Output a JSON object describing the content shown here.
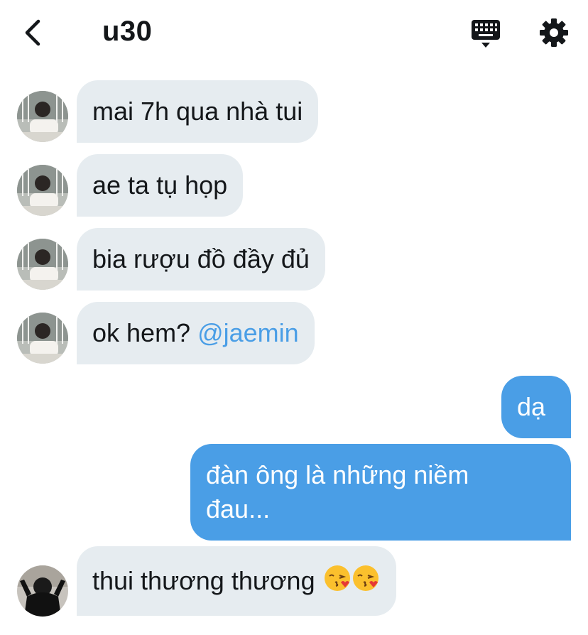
{
  "header": {
    "title": "u30",
    "back_icon": "chevron-left-icon",
    "keyboard_icon": "keyboard-icon",
    "settings_icon": "gear-icon"
  },
  "colors": {
    "incoming_bubble": "#e6ecf0",
    "outgoing_bubble": "#4a9ee6",
    "mention": "#4a9ee6",
    "text": "#14171a"
  },
  "messages": [
    {
      "direction": "incoming",
      "text": "mai 7h qua nhà tui"
    },
    {
      "direction": "incoming",
      "text": "ae ta tụ họp"
    },
    {
      "direction": "incoming",
      "text": "bia rượu đồ đầy đủ"
    },
    {
      "direction": "incoming",
      "text": "ok hem? ",
      "mention": "@jaemin"
    },
    {
      "direction": "outgoing",
      "text": "dạ"
    },
    {
      "direction": "outgoing",
      "line1": "đàn ông là những niềm",
      "line2": "đau..."
    },
    {
      "direction": "incoming",
      "text": "thui thương thương ",
      "emoji": "kissing-face-emoji"
    }
  ]
}
